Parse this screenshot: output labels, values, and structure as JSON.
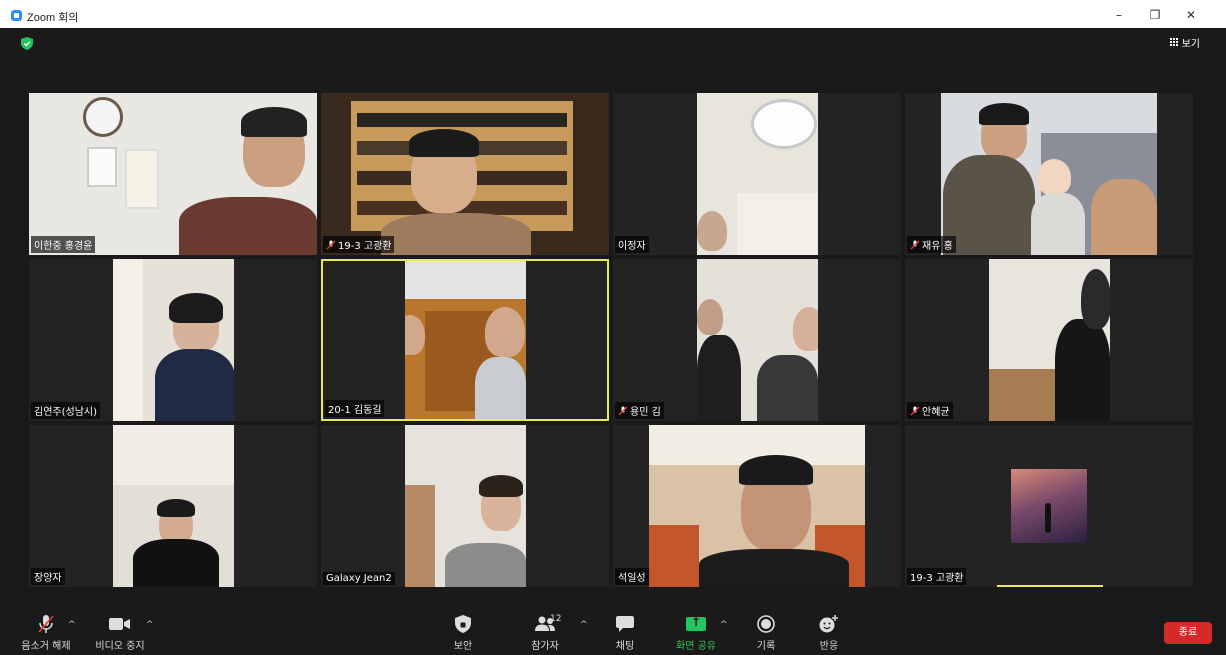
{
  "window": {
    "title": "Zoom 회의",
    "minimize": "–",
    "maximize": "❐",
    "close": "✕"
  },
  "top": {
    "view_label": "보기"
  },
  "participants": [
    {
      "name": "이한중 홍경윤",
      "muted": false,
      "active": false
    },
    {
      "name": "19-3 고광환",
      "muted": true,
      "active": false
    },
    {
      "name": "이정자",
      "muted": false,
      "active": false
    },
    {
      "name": "재유 홍",
      "muted": true,
      "active": false
    },
    {
      "name": "김연주(성남시)",
      "muted": false,
      "active": false
    },
    {
      "name": "20-1 김동길",
      "muted": false,
      "active": true
    },
    {
      "name": "용민 김",
      "muted": true,
      "active": false
    },
    {
      "name": "안혜균",
      "muted": true,
      "active": false
    },
    {
      "name": "장양자",
      "muted": false,
      "active": false
    },
    {
      "name": "Galaxy Jean2",
      "muted": false,
      "active": false
    },
    {
      "name": "석일성",
      "muted": false,
      "active": false
    },
    {
      "name": "19-3 고광환",
      "muted": false,
      "active": false
    }
  ],
  "toolbar": {
    "unmute_label": "음소거 해제",
    "stop_video_label": "비디오 중지",
    "security_label": "보안",
    "participants_label": "참가자",
    "participants_count": "12",
    "chat_label": "채팅",
    "share_screen_label": "화면 공유",
    "record_label": "기록",
    "reactions_label": "반응",
    "end_label": "종료",
    "caret": "^"
  },
  "colors": {
    "accent_green": "#22c55e",
    "end_red": "#d42a2a",
    "active_border": "#e8e85a"
  }
}
